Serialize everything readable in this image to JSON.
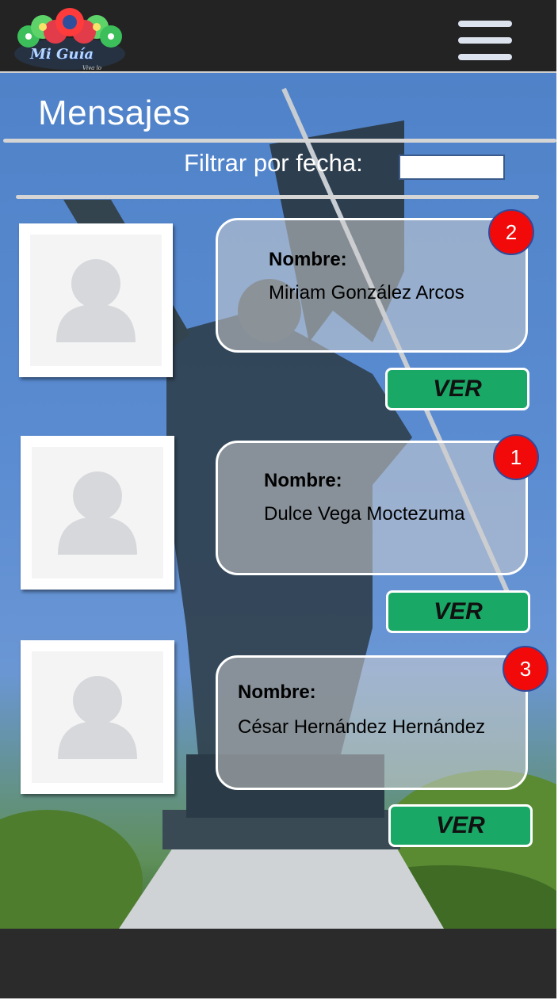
{
  "header": {
    "logo_text": "Mi Guía",
    "logo_tagline": "Viva lo Histórico",
    "menu_icon": "hamburger-menu-icon"
  },
  "page": {
    "title": "Mensajes",
    "filter_label": "Filtrar por fecha:",
    "filter_value": ""
  },
  "messages": [
    {
      "label": "Nombre:",
      "name": "Miriam González Arcos",
      "badge": "2",
      "button": "VER"
    },
    {
      "label": "Nombre:",
      "name": "Dulce Vega Moctezuma",
      "badge": "1",
      "button": "VER"
    },
    {
      "label": "Nombre:",
      "name": "César Hernández Hernández",
      "badge": "3",
      "button": "VER"
    }
  ],
  "colors": {
    "header_bg": "#232323",
    "badge": "#f20a0a",
    "button": "#19a865"
  }
}
